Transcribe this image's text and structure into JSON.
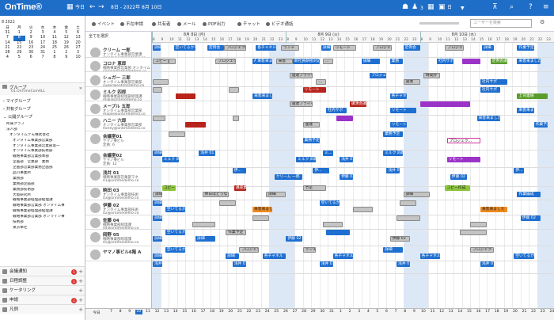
{
  "app": {
    "logo": "OnTime®"
  },
  "toolbar": {
    "today": "今日",
    "date_range": "8日 - 2022年 8月 10日",
    "count": "3",
    "unit": "日",
    "search_placeholder": "ユーザーを検索"
  },
  "secondary": {
    "items": [
      "イベント",
      "不在申請",
      "共有者",
      "メール",
      "PDF出力",
      "チャット",
      "ビデオ通話"
    ]
  },
  "calendar": {
    "title": "8 2022",
    "weekdays": [
      "日",
      "月",
      "火",
      "水",
      "木",
      "金",
      "土"
    ],
    "rows": [
      [
        "31",
        "1",
        "2",
        "3",
        "4",
        "5",
        "6"
      ],
      [
        "7",
        "8",
        "9",
        "10",
        "11",
        "12",
        "13"
      ],
      [
        "14",
        "15",
        "16",
        "17",
        "18",
        "19",
        "20"
      ],
      [
        "21",
        "22",
        "23",
        "24",
        "25",
        "26",
        "27"
      ],
      [
        "28",
        "29",
        "30",
        "31",
        "1",
        "2",
        "3"
      ],
      [
        "4",
        "5",
        "6",
        "7",
        "8",
        "9",
        "10"
      ]
    ]
  },
  "sidebar": {
    "group_title": "グループ",
    "group_sub": "01.OnTimeComALL",
    "my_group": "マイグループ",
    "shared_group": "共有グループ",
    "public_group": "公開グループ",
    "tree": [
      "所属クラブ",
      "法人部",
      "オンタイムデモ株式会社",
      "オンタイム事業部営業部",
      "オンタイム事業部営業部第一",
      "オンタイム事業部技術部",
      "戦略事業部営業部本部",
      "企画部　営業部　業務",
      "企画部営業部業務企画部",
      "品川事業所",
      "業務部",
      "業務部企画部",
      "業務部技術部",
      "大阪研究所",
      "戦略事業部経理部経理課",
      "戦略事業部営業部 オンタイム事",
      "戦略事業部経理部経理課",
      "戦略事業部営業部 オンライン事",
      "技術部",
      "東京本社"
    ],
    "modules": [
      {
        "label": "会議通知",
        "badge": "1"
      },
      {
        "label": "日程調整",
        "badge": "1"
      },
      {
        "label": "ケータリング",
        "badge": ""
      },
      {
        "label": "申請",
        "badge": "2"
      },
      {
        "label": "凡例",
        "badge": ""
      }
    ]
  },
  "persons": [
    {
      "name": "クリーム 一郎",
      "sub": "オンタイム事業部営業課",
      "email": "cream@ontimedemo.co"
    },
    {
      "name": "コロナ 恵郎",
      "sub": "戦略事業部営業部 オンタイム",
      "email": "corona@ontimedemo.co"
    },
    {
      "name": "シュガー 三郎",
      "sub": "オンタイム事業部営業部",
      "email": "sugar@ontimedemo.co"
    },
    {
      "name": "ミルク 四郎",
      "sub": "戦略事業部経理部経理課",
      "email": "milk@ontimedemo.co"
    },
    {
      "name": "メープル 五郎",
      "sub": "オンタイム事業部営業部",
      "email": "maple@ontimedemo.co"
    },
    {
      "name": "ハニー 六郎",
      "sub": "オンタイム事業部営業部",
      "email": "honey@ontimedemo.co"
    },
    {
      "name": "会議室01",
      "sub": "ヤマノ事ビル",
      "email": "定員: 6"
    },
    {
      "name": "会議室02",
      "sub": "ヤマノ事ビル",
      "email": "定員: 12"
    },
    {
      "name": "浅井 01",
      "sub": "戦略事業部営業部マネ",
      "email": "01@ontimedemo.co"
    },
    {
      "name": "暁田 03",
      "sub": "オンタイム事業部技術",
      "email": "03@ontimedemo.co"
    },
    {
      "name": "伊藤 02",
      "sub": "オンタイム事業部技術",
      "email": "02@ontimedemo.co"
    },
    {
      "name": "佐藤 04",
      "sub": "戦略事業部経理課",
      "email": "04@ontimedemo.co"
    },
    {
      "name": "岡野 05",
      "sub": "戦略事業部経理課",
      "email": "05@ontimedemo.co"
    },
    {
      "name": "ヤマノ事ビル6階 A",
      "sub": "",
      "email": ""
    }
  ],
  "timeline": {
    "days": [
      "8月 8日 (月)",
      "8月 9日 (火)",
      "8月 10日 (水)"
    ],
    "hours": [
      "8",
      "9",
      "10",
      "11",
      "12",
      "13",
      "14",
      "15",
      "16",
      "17",
      "18",
      "19",
      "20",
      "21",
      "22",
      "23"
    ],
    "select_all": "全てを選択"
  },
  "events": [
    {
      "r": 0,
      "s": 0.5,
      "e": 5,
      "c": "blue",
      "t": "詳細"
    },
    {
      "r": 0,
      "s": 13,
      "e": 26,
      "c": "blue",
      "t": "空いてるかも"
    },
    {
      "r": 0,
      "s": 33,
      "e": 43,
      "c": "blue",
      "t": "定例会"
    },
    {
      "r": 0,
      "s": 43,
      "e": 56,
      "c": "gray",
      "t": "プロジェク..."
    },
    {
      "r": 0,
      "s": 62,
      "e": 74,
      "c": "blue",
      "t": "各チャネル..."
    },
    {
      "r": 0,
      "s": 77,
      "e": 88,
      "c": "gray",
      "t": "ランチ"
    },
    {
      "r": 0,
      "s": 101,
      "e": 107,
      "c": "blue",
      "t": "詳細"
    },
    {
      "r": 0,
      "s": 108,
      "e": 122,
      "c": "gray",
      "t": "リモート"
    },
    {
      "r": 0,
      "s": 132,
      "e": 143,
      "c": "gray",
      "t": "プロジェク..."
    },
    {
      "r": 0,
      "s": 150,
      "e": 160,
      "c": "blue",
      "t": "定例会"
    },
    {
      "r": 0,
      "s": 175,
      "e": 186,
      "c": "gray",
      "t": "プロジェク..."
    },
    {
      "r": 0,
      "s": 197,
      "e": 204,
      "c": "blue",
      "t": "詳細"
    },
    {
      "r": 0,
      "s": 218,
      "e": 228,
      "c": "blue",
      "t": "作業予定"
    },
    {
      "r": 1,
      "s": 0.5,
      "e": 10,
      "c": "gray",
      "t": "コピー"
    },
    {
      "r": 1,
      "s": 10,
      "e": 14,
      "c": "gray",
      "t": ""
    },
    {
      "r": 1,
      "s": 38,
      "e": 50,
      "c": "gray",
      "t": "プロジェク..."
    },
    {
      "r": 1,
      "s": 60,
      "e": 62,
      "c": "blue",
      "t": "A"
    },
    {
      "r": 1,
      "s": 62,
      "e": 72,
      "c": "blue",
      "t": "来客来ました"
    },
    {
      "r": 1,
      "s": 74,
      "e": 84,
      "c": "gray",
      "t": "来客"
    },
    {
      "r": 1,
      "s": 84,
      "e": 100,
      "c": "blue",
      "t": "新社員研修対応"
    },
    {
      "r": 1,
      "s": 102,
      "e": 108,
      "c": "gray",
      "t": "..."
    },
    {
      "r": 1,
      "s": 125,
      "e": 136,
      "c": "blue",
      "t": "詳細"
    },
    {
      "r": 1,
      "s": 142,
      "e": 150,
      "c": "blue",
      "t": "業務"
    },
    {
      "r": 1,
      "s": 170,
      "e": 180,
      "c": "blue",
      "t": "社内サポ"
    },
    {
      "r": 1,
      "s": 185,
      "e": 196,
      "c": "purple",
      "t": ""
    },
    {
      "r": 1,
      "s": 202,
      "e": 212,
      "c": "green",
      "t": "定例会議"
    },
    {
      "r": 1,
      "s": 218,
      "e": 232,
      "c": "blue",
      "t": "来客来ました"
    },
    {
      "r": 2,
      "s": 0.5,
      "e": 10,
      "c": "gray",
      "t": ""
    },
    {
      "r": 2,
      "s": 82,
      "e": 96,
      "c": "gray",
      "t": "速達プライベート"
    },
    {
      "r": 2,
      "s": 98,
      "e": 104,
      "c": "gray",
      "t": "..."
    },
    {
      "r": 2,
      "s": 130,
      "e": 140,
      "c": "blue",
      "t": "プロジェク..."
    },
    {
      "r": 2,
      "s": 150,
      "e": 160,
      "c": "gray",
      "t": "速達"
    },
    {
      "r": 2,
      "s": 162,
      "e": 172,
      "c": "gray",
      "t": "時間外"
    },
    {
      "r": 2,
      "s": 196,
      "e": 212,
      "c": "blue",
      "t": "社内サポ"
    },
    {
      "r": 3,
      "s": 0.5,
      "e": 6,
      "c": "gray",
      "t": ""
    },
    {
      "r": 3,
      "s": 14,
      "e": 26,
      "c": "red",
      "t": ""
    },
    {
      "r": 3,
      "s": 46,
      "e": 52,
      "c": "gray",
      "t": ""
    },
    {
      "r": 3,
      "s": 60,
      "e": 72,
      "c": "blue",
      "t": "来客来ました"
    },
    {
      "r": 3,
      "s": 90,
      "e": 104,
      "c": "red",
      "t": "リモート"
    },
    {
      "r": 3,
      "s": 142,
      "e": 152,
      "c": "blue",
      "t": "各チャネル"
    },
    {
      "r": 3,
      "s": 196,
      "e": 208,
      "c": "blue",
      "t": "社内サポ"
    },
    {
      "r": 3,
      "s": 218,
      "e": 236,
      "c": "green",
      "t": "上司連絡"
    },
    {
      "r": 4,
      "s": 82,
      "e": 96,
      "c": "gray",
      "t": "速達プライベート"
    },
    {
      "r": 4,
      "s": 104,
      "e": 116,
      "c": "blue",
      "t": "社内サポ"
    },
    {
      "r": 4,
      "s": 118,
      "e": 128,
      "c": "red",
      "t": "講演会議"
    },
    {
      "r": 4,
      "s": 142,
      "e": 158,
      "c": "blue",
      "t": "リモート"
    },
    {
      "r": 4,
      "s": 160,
      "e": 190,
      "c": "purple",
      "t": ""
    },
    {
      "r": 4,
      "s": 218,
      "e": 228,
      "c": "blue",
      "t": "来客来ました"
    },
    {
      "r": 5,
      "s": 0.5,
      "e": 8,
      "c": "gray",
      "t": ""
    },
    {
      "r": 5,
      "s": 20,
      "e": 32,
      "c": "red",
      "t": ""
    },
    {
      "r": 5,
      "s": 48,
      "e": 52,
      "c": "gray",
      "t": ""
    },
    {
      "r": 5,
      "s": 90,
      "e": 100,
      "c": "gray",
      "t": "速達"
    },
    {
      "r": 5,
      "s": 110,
      "e": 120,
      "c": "purple",
      "t": ""
    },
    {
      "r": 5,
      "s": 142,
      "e": 152,
      "c": "blue",
      "t": "リモート"
    },
    {
      "r": 5,
      "s": 194,
      "e": 208,
      "c": "blue",
      "t": "来客来ました"
    },
    {
      "r": 5,
      "s": 228,
      "e": 236,
      "c": "blue",
      "t": "作業予定"
    },
    {
      "r": 6,
      "s": 10,
      "e": 20,
      "c": "gray",
      "t": ""
    },
    {
      "r": 6,
      "s": 90,
      "e": 100,
      "c": "blue",
      "t": "業務予定"
    },
    {
      "r": 6,
      "s": 138,
      "e": 150,
      "c": "blue",
      "t": "業務予定"
    },
    {
      "r": 6,
      "s": 176,
      "e": 196,
      "c": "pink",
      "t": "プロジェク..."
    },
    {
      "r": 7,
      "s": 0.5,
      "e": 6,
      "c": "blue",
      "t": "詳細"
    },
    {
      "r": 7,
      "s": 6,
      "e": 16,
      "c": "blue",
      "t": "ミルク 四郎"
    },
    {
      "r": 7,
      "s": 28,
      "e": 38,
      "c": "blue",
      "t": "浅井 01"
    },
    {
      "r": 7,
      "s": 86,
      "e": 98,
      "c": "blue",
      "t": "ミルク 四郎"
    },
    {
      "r": 7,
      "s": 102,
      "e": 108,
      "c": "blue",
      "t": "ミ..."
    },
    {
      "r": 7,
      "s": 112,
      "e": 120,
      "c": "blue",
      "t": "浅井 01"
    },
    {
      "r": 7,
      "s": 138,
      "e": 150,
      "c": "blue",
      "t": "ミルク 四郎"
    },
    {
      "r": 7,
      "s": 176,
      "e": 196,
      "c": "purple",
      "t": "リモート"
    },
    {
      "r": 8,
      "s": 48,
      "e": 56,
      "c": "blue",
      "t": "伊..."
    },
    {
      "r": 8,
      "s": 73,
      "e": 90,
      "c": "blue",
      "t": "クリーム 一郎"
    },
    {
      "r": 8,
      "s": 96,
      "e": 106,
      "c": "blue",
      "t": "伊..."
    },
    {
      "r": 8,
      "s": 112,
      "e": 120,
      "c": "blue",
      "t": "伊藤 02"
    },
    {
      "r": 8,
      "s": 140,
      "e": 148,
      "c": "blue",
      "t": "浅井 01"
    },
    {
      "r": 8,
      "s": 178,
      "e": 188,
      "c": "blue",
      "t": "伊藤 02"
    },
    {
      "r": 8,
      "s": 216,
      "e": 222,
      "c": "blue",
      "t": "伊..."
    },
    {
      "r": 9,
      "s": 0.5,
      "e": 6,
      "c": "gray",
      "t": "詳細"
    },
    {
      "r": 9,
      "s": 6,
      "e": 14,
      "c": "lime",
      "t": "コピー"
    },
    {
      "r": 9,
      "s": 30,
      "e": 46,
      "c": "gray",
      "t": "休日はどうなるの"
    },
    {
      "r": 9,
      "s": 49,
      "e": 56,
      "c": "red",
      "t": "講座業務"
    },
    {
      "r": 9,
      "s": 68,
      "e": 80,
      "c": "gray",
      "t": "詳細"
    },
    {
      "r": 9,
      "s": 90,
      "e": 104,
      "c": "gray",
      "t": "予定"
    },
    {
      "r": 9,
      "s": 150,
      "e": 166,
      "c": "gray",
      "t": "詳細"
    },
    {
      "r": 9,
      "s": 175,
      "e": 190,
      "c": "lime",
      "t": "コピー作成"
    },
    {
      "r": 9,
      "s": 218,
      "e": 232,
      "c": "blue",
      "t": "作業編成"
    },
    {
      "r": 10,
      "s": 0.5,
      "e": 6,
      "c": "blue",
      "t": "詳細"
    },
    {
      "r": 10,
      "s": 8,
      "e": 20,
      "c": "blue",
      "t": "空いてるかも"
    },
    {
      "r": 10,
      "s": 40,
      "e": 50,
      "c": "gray",
      "t": ""
    },
    {
      "r": 10,
      "s": 60,
      "e": 72,
      "c": "orange",
      "t": "来客来ました"
    },
    {
      "r": 10,
      "s": 100,
      "e": 112,
      "c": "blue",
      "t": "空いてるかも"
    },
    {
      "r": 10,
      "s": 120,
      "e": 132,
      "c": "gray",
      "t": ""
    },
    {
      "r": 10,
      "s": 148,
      "e": 158,
      "c": "gray",
      "t": ""
    },
    {
      "r": 10,
      "s": 196,
      "e": 212,
      "c": "orange",
      "t": "来客来ました"
    },
    {
      "r": 11,
      "s": 0.5,
      "e": 6,
      "c": "blue",
      "t": "詳細"
    },
    {
      "r": 11,
      "s": 24,
      "e": 38,
      "c": "gray",
      "t": ""
    },
    {
      "r": 11,
      "s": 60,
      "e": 70,
      "c": "gray",
      "t": ""
    },
    {
      "r": 11,
      "s": 102,
      "e": 114,
      "c": "gray",
      "t": ""
    },
    {
      "r": 11,
      "s": 146,
      "e": 160,
      "c": "gray",
      "t": ""
    },
    {
      "r": 11,
      "s": 190,
      "e": 200,
      "c": "gray",
      "t": ""
    },
    {
      "r": 11,
      "s": 220,
      "e": 232,
      "c": "blue",
      "t": "伊藤 02"
    },
    {
      "r": 12,
      "s": 0.5,
      "e": 6,
      "c": "blue",
      "t": "詳細"
    },
    {
      "r": 12,
      "s": 8,
      "e": 20,
      "c": "blue",
      "t": "空いてるかも"
    },
    {
      "r": 12,
      "s": 26,
      "e": 38,
      "c": "blue",
      "t": "詳細"
    },
    {
      "r": 12,
      "s": 44,
      "e": 56,
      "c": "gray",
      "t": "作業予定"
    },
    {
      "r": 12,
      "s": 80,
      "e": 90,
      "c": "blue",
      "t": "伊藤 02"
    },
    {
      "r": 12,
      "s": 104,
      "e": 118,
      "c": "blue",
      "t": ""
    },
    {
      "r": 12,
      "s": 142,
      "e": 154,
      "c": "gray",
      "t": "伊藤 02"
    },
    {
      "r": 12,
      "s": 184,
      "e": 200,
      "c": "gray",
      "t": ""
    },
    {
      "r": 13,
      "s": 0.5,
      "e": 6,
      "c": "blue",
      "t": "詳細"
    },
    {
      "r": 13,
      "s": 8,
      "e": 20,
      "c": "blue",
      "t": "空いてるかも"
    },
    {
      "r": 13,
      "s": 44,
      "e": 52,
      "c": "blue",
      "t": "詳細"
    },
    {
      "r": 13,
      "s": 52,
      "e": 64,
      "c": "gray",
      "t": "プロジェク..."
    },
    {
      "r": 13,
      "s": 66,
      "e": 80,
      "c": "blue",
      "t": "各チャネル"
    },
    {
      "r": 13,
      "s": 90,
      "e": 98,
      "c": "gray",
      "t": "ランチ"
    },
    {
      "r": 13,
      "s": 108,
      "e": 120,
      "c": "blue",
      "t": "各チャネル"
    },
    {
      "r": 13,
      "s": 138,
      "e": 150,
      "c": "blue",
      "t": "詳細"
    },
    {
      "r": 13,
      "s": 160,
      "e": 172,
      "c": "blue",
      "t": "各チャネル"
    },
    {
      "r": 13,
      "s": 190,
      "e": 204,
      "c": "gray",
      "t": "プロジェク..."
    },
    {
      "r": 13,
      "s": 216,
      "e": 228,
      "c": "blue",
      "t": "空いてるかも"
    },
    {
      "r": 14,
      "s": 0.5,
      "e": 6,
      "c": "blue",
      "t": "浅井 01"
    },
    {
      "r": 14,
      "s": 48,
      "e": 56,
      "c": "blue",
      "t": "浅井 01"
    },
    {
      "r": 14,
      "s": 100,
      "e": 108,
      "c": "blue",
      "t": "浅井 01"
    },
    {
      "r": 14,
      "s": 146,
      "e": 154,
      "c": "blue",
      "t": "浅井 01"
    },
    {
      "r": 14,
      "s": 196,
      "e": 204,
      "c": "blue",
      "t": "浅井 01"
    }
  ],
  "rows_y": [
    [
      3,
      17
    ],
    [
      20,
      35
    ],
    [
      38,
      54
    ],
    [
      56,
      72
    ],
    [
      74,
      90
    ],
    [
      92,
      110
    ],
    [
      112,
      134
    ],
    [
      136,
      156
    ],
    [
      158,
      180
    ],
    [
      180,
      197
    ],
    [
      199,
      216
    ],
    [
      218,
      234
    ],
    [
      236,
      255
    ],
    [
      258,
      274
    ],
    [
      276,
      290
    ]
  ],
  "bottom": {
    "label": "今日",
    "days": [
      "7",
      "8",
      "9",
      "10",
      "11",
      "12",
      "13",
      "14",
      "15",
      "16",
      "17",
      "18",
      "19",
      "20",
      "21",
      "22",
      "23",
      "24",
      "25",
      "26",
      "27",
      "28",
      "29",
      "30",
      "31",
      "1",
      "2",
      "3",
      "4",
      "5",
      "6",
      "7",
      "8",
      "9",
      "10",
      "11",
      "12",
      "13",
      "14",
      "15",
      "16",
      "17",
      "18",
      "19",
      "20",
      "21",
      "22",
      "23",
      "24"
    ]
  },
  "colors": {
    "topbar": "#1e6ec8",
    "event_blue": "#1f6fd0",
    "band": "#dde8f6"
  }
}
